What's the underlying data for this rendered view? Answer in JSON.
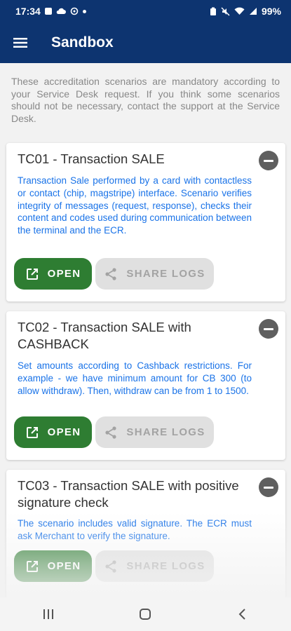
{
  "status_bar": {
    "time": "17:34",
    "battery": "99%"
  },
  "app_bar": {
    "title": "Sandbox"
  },
  "intro": "These accreditation scenarios are mandatory according to your Service Desk request. If you think some scenarios should not be necessary, contact the support at the Service Desk.",
  "cards": [
    {
      "title": "TC01 - Transaction SALE",
      "description": "Transaction Sale performed by a card with contactless or contact (chip, magstripe) interface. Scenario verifies integrity of messages (request, response), checks their content and codes used during communication between the terminal and the ECR.",
      "open_label": "OPEN",
      "share_label": "SHARE LOGS"
    },
    {
      "title": "TC02 - Transaction SALE with CASHBACK",
      "description": "Set amounts according to Cashback restrictions. For example - we have minimum amount for CB 300 (to allow withdraw). Then, withdraw can be from 1 to 1500.",
      "open_label": "OPEN",
      "share_label": "SHARE LOGS"
    },
    {
      "title": "TC03 - Transaction SALE with positive signature check",
      "description": "The scenario includes valid signature. The ECR must ask Merchant to verify the signature.",
      "open_label": "OPEN",
      "share_label": "SHARE LOGS"
    }
  ],
  "colors": {
    "app_bar": "#0d3470",
    "open_button": "#2e7d32",
    "description_text": "#1a73e8"
  }
}
